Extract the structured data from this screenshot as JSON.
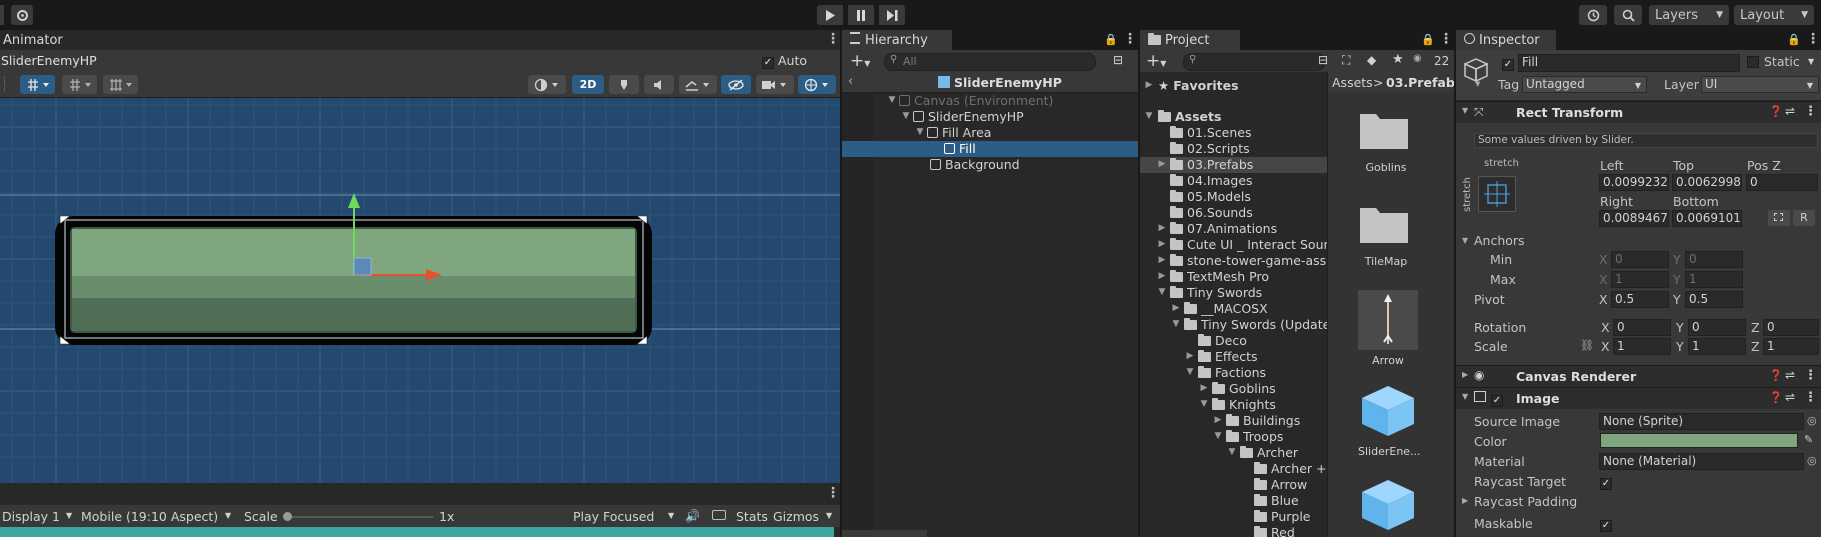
{
  "toolbar": {
    "layers_label": "Layers",
    "layout_label": "Layout"
  },
  "animator": {
    "tab": "Animator",
    "object_name": "SliderEnemyHP",
    "auto_save_label": "Auto Save",
    "mode_2d": "2D",
    "footer": {
      "display": "Display 1",
      "aspect": "Mobile (19:10 Aspect)",
      "scale_label": "Scale",
      "scale_value": "1x",
      "play_focused": "Play Focused",
      "stats": "Stats",
      "gizmos": "Gizmos"
    }
  },
  "hierarchy": {
    "tab": "Hierarchy",
    "search_placeholder": "All",
    "scene_title": "SliderEnemyHP",
    "items": [
      {
        "label": "Canvas (Environment)"
      },
      {
        "label": "SliderEnemyHP"
      },
      {
        "label": "Fill Area"
      },
      {
        "label": "Fill"
      },
      {
        "label": "Background"
      }
    ]
  },
  "project": {
    "tab": "Project",
    "badge_count": "22",
    "favorites": "Favorites",
    "assets_root": "Assets",
    "tree": [
      "01.Scenes",
      "02.Scripts",
      "03.Prefabs",
      "04.Images",
      "05.Models",
      "06.Sounds",
      "07.Animations",
      "Cute UI _ Interact Sound",
      "stone-tower-game-asse",
      "TextMesh Pro",
      "Tiny Swords",
      "__MACOSX",
      "Tiny Swords (Update (",
      "Deco",
      "Effects",
      "Factions",
      "Goblins",
      "Knights",
      "Buildings",
      "Troops",
      "Archer",
      "Archer + B",
      "Arrow",
      "Blue",
      "Purple",
      "Red"
    ],
    "breadcrumb": {
      "root": "Assets",
      "sep": ">",
      "current": "03.Prefabs"
    },
    "grid": [
      {
        "label": "Goblins",
        "icon": "folder-icon"
      },
      {
        "label": "TileMap",
        "icon": "folder-icon"
      },
      {
        "label": "Arrow",
        "icon": "arrow-sprite-icon"
      },
      {
        "label": "SliderEne...",
        "icon": "prefab-cube-icon"
      },
      {
        "label": "",
        "icon": "prefab-cube-icon"
      }
    ]
  },
  "inspector": {
    "tab": "Inspector",
    "object_name": "Fill",
    "static_label": "Static",
    "tag_label": "Tag",
    "tag_value": "Untagged",
    "layer_label": "Layer",
    "layer_value": "UI",
    "rect_transform": {
      "title": "Rect Transform",
      "note": "Some values driven by Slider.",
      "anchor_preset_top": "stretch",
      "anchor_preset_side": "stretch",
      "left_label": "Left",
      "left": "0.00992328",
      "top_label": "Top",
      "top": "0.00629982",
      "posz_label": "Pos Z",
      "posz": "0",
      "right_label": "Right",
      "right": "0.00894671",
      "bottom_label": "Bottom",
      "bottom": "0.00691017",
      "r_button": "R",
      "anchors_label": "Anchors",
      "min_label": "Min",
      "min_x": "0",
      "min_y": "0",
      "max_label": "Max",
      "max_x": "1",
      "max_y": "1",
      "pivot_label": "Pivot",
      "pivot_x": "0.5",
      "pivot_y": "0.5",
      "rotation_label": "Rotation",
      "rot_x": "0",
      "rot_y": "0",
      "rot_z": "0",
      "scale_label": "Scale",
      "scale_x": "1",
      "scale_y": "1",
      "scale_z": "1"
    },
    "canvas_renderer": {
      "title": "Canvas Renderer"
    },
    "image": {
      "title": "Image",
      "source_image_label": "Source Image",
      "source_image": "None (Sprite)",
      "color_label": "Color",
      "color": "#7fa67f",
      "material_label": "Material",
      "material": "None (Material)",
      "raycast_target_label": "Raycast Target",
      "raycast_padding_label": "Raycast Padding",
      "maskable_label": "Maskable"
    },
    "axis": {
      "x": "X",
      "y": "Y",
      "z": "Z"
    }
  },
  "colors": {
    "accent": "#2c5d87",
    "selection": "#2c5d87",
    "scene_bg": "#234a6e",
    "fill_green": "#7fa67f"
  }
}
